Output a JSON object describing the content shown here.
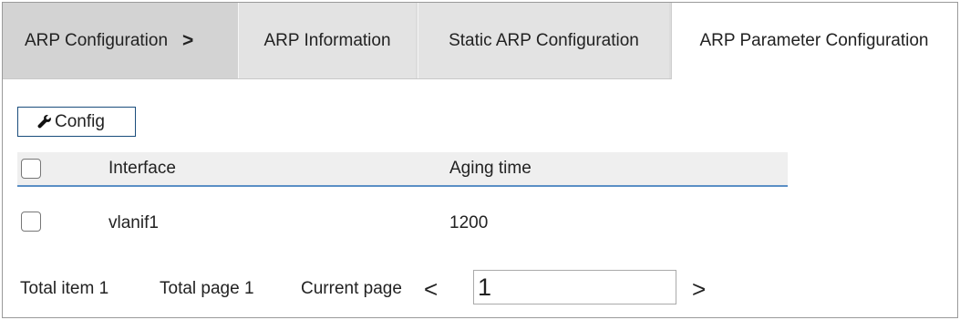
{
  "breadcrumb": {
    "label": "ARP Configuration",
    "separator": ">"
  },
  "tabs": [
    {
      "label": "ARP Information"
    },
    {
      "label": "Static ARP Configuration"
    },
    {
      "label": "ARP Parameter Configuration",
      "active": true
    }
  ],
  "toolbar": {
    "config_label": "Config",
    "config_icon": "wrench-icon"
  },
  "table": {
    "headers": [
      "Interface",
      "Aging time"
    ],
    "rows": [
      {
        "interface": "vlanif1",
        "aging_time": "1200"
      }
    ]
  },
  "pagination": {
    "total_item": "Total item 1",
    "total_page": "Total page 1",
    "current_page_label": "Current page",
    "prev": "<",
    "next": ">",
    "current_page_value": "1"
  },
  "colors": {
    "accent": "#1a4d7c",
    "header_underline": "#5b8fc5"
  }
}
